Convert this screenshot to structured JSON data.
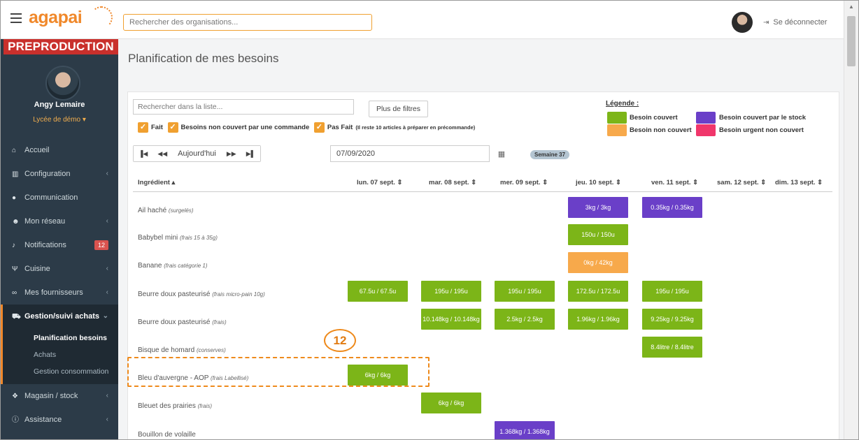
{
  "topbar": {
    "logo_text": "agapai",
    "search_placeholder": "Rechercher des organisations...",
    "logout_label": "Se déconnecter"
  },
  "sidebar": {
    "env_label": "PREPRODUCTION",
    "user_name": "Angy Lemaire",
    "school": "Lycée de démo ▾",
    "items": [
      {
        "label": "Accueil",
        "icon": "home-icon"
      },
      {
        "label": "Configuration",
        "icon": "bank-icon"
      },
      {
        "label": "Communication",
        "icon": "chat-icon"
      },
      {
        "label": "Mon réseau",
        "icon": "users-icon"
      },
      {
        "label": "Notifications",
        "icon": "bell-icon",
        "badge": "12"
      },
      {
        "label": "Cuisine",
        "icon": "utensils-icon"
      },
      {
        "label": "Mes fournisseurs",
        "icon": "handshake-icon"
      },
      {
        "label": "Gestion/suivi achats",
        "icon": "cart-icon"
      },
      {
        "label": "Magasin / stock",
        "icon": "cubes-icon"
      },
      {
        "label": "Assistance",
        "icon": "info-icon"
      }
    ],
    "subitems": [
      "Planification besoins",
      "Achats",
      "Gestion consommation"
    ]
  },
  "main": {
    "title": "Planification de mes besoins",
    "list_search_placeholder": "Rechercher dans la liste...",
    "more_filters": "Plus de filtres",
    "filters": {
      "fait": "Fait",
      "non_couvert": "Besoins non couvert par une commande",
      "pas_fait": "Pas Fait",
      "pas_fait_note": "(Il reste 10 articles à préparer en précommande)"
    },
    "legend": {
      "title": "Légende :",
      "couvert": "Besoin couvert",
      "non_couvert": "Besoin non couvert",
      "stock": "Besoin couvert par le stock",
      "urgent": "Besoin urgent non couvert"
    },
    "nav": {
      "first": "▐◀",
      "prev": "◀◀",
      "today": "Aujourd'hui",
      "next": "▶▶",
      "last": "▶▌"
    },
    "date_value": "07/09/2020",
    "week": "Semaine 37",
    "columns": {
      "ingredient": "Ingrédient ▴",
      "days": [
        "lun. 07 sept. ⇕",
        "mar. 08 sept. ⇕",
        "mer. 09 sept. ⇕",
        "jeu. 10 sept. ⇕",
        "ven. 11 sept. ⇕",
        "sam. 12 sept. ⇕",
        "dim. 13 sept. ⇕"
      ]
    },
    "rows": [
      {
        "name": "Ail haché",
        "detail": "(surgelés)"
      },
      {
        "name": "Babybel mini",
        "detail": "(frais 15 à 35g)"
      },
      {
        "name": "Banane",
        "detail": "(frais catégorie 1)"
      },
      {
        "name": "Beurre doux pasteurisé",
        "detail": "(frais micro-pain 10g)"
      },
      {
        "name": "Beurre doux pasteurisé",
        "detail": "(frais)"
      },
      {
        "name": "Bisque de homard",
        "detail": "(conserves)"
      },
      {
        "name": "Bleu d'auvergne - AOP",
        "detail": "(frais Labellisé)"
      },
      {
        "name": "Bleuet des prairies",
        "detail": "(frais)"
      },
      {
        "name": "Bouillon de volaille",
        "detail": ""
      }
    ],
    "cells": {
      "r0_jeu": "3kg / 3kg",
      "r0_ven": "0.35kg / 0.35kg",
      "r1_jeu": "150u / 150u",
      "r2_jeu": "0kg / 42kg",
      "r3_lun": "67.5u / 67.5u",
      "r3_mar": "195u / 195u",
      "r3_mer": "195u / 195u",
      "r3_jeu": "172.5u / 172.5u",
      "r3_ven": "195u / 195u",
      "r4_mar": "10.148kg / 10.148kg",
      "r4_mer": "2.5kg / 2.5kg",
      "r4_jeu": "1.96kg / 1.96kg",
      "r4_ven": "9.25kg / 9.25kg",
      "r5_ven": "8.4litre / 8.4litre",
      "r6_lun": "6kg / 6kg",
      "r7_mar": "6kg / 6kg",
      "r8_mer": "1.368kg / 1.368kg"
    }
  },
  "annotation": {
    "step": "12"
  },
  "colors": {
    "green": "#7cb518",
    "purple": "#6a3fc8",
    "orange": "#f7a94b",
    "pink": "#f0366b",
    "accent": "#f0882a"
  }
}
